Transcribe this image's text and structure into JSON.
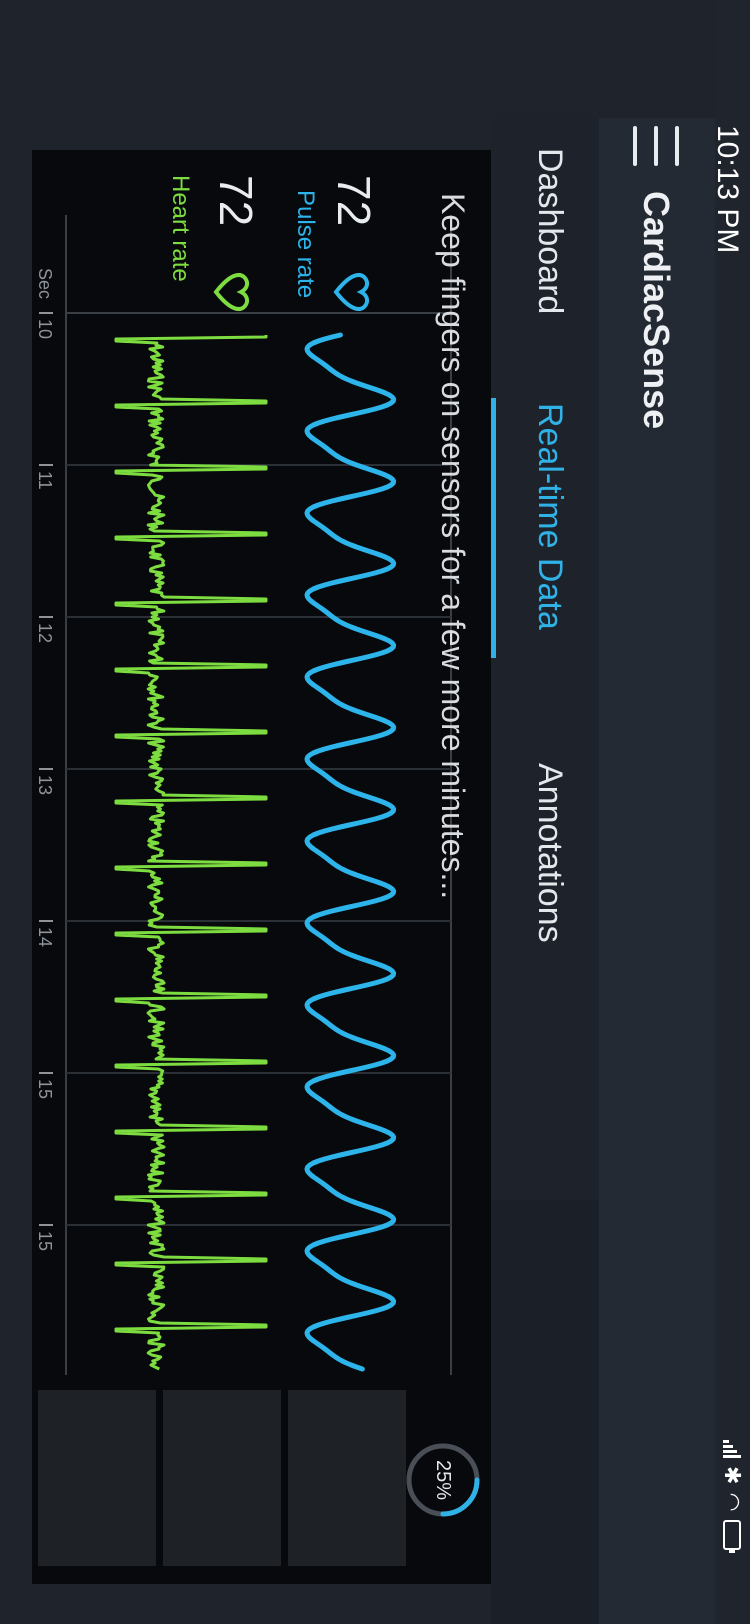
{
  "status_bar": {
    "time": "10:13 PM"
  },
  "app": {
    "title": "CardiacSense"
  },
  "tabs": [
    {
      "label": "Dashboard"
    },
    {
      "label": "Real-time Data",
      "active": true
    },
    {
      "label": "Annotations"
    }
  ],
  "panel": {
    "guidance": "Keep fingers on sensors for a few more minutes...",
    "progress": {
      "percent_label": "25%",
      "value": 0.25
    },
    "pulse": {
      "value": "72",
      "label": "Pulse rate",
      "color": "#2db4ea"
    },
    "heart": {
      "value": "72",
      "label": "Heart rate",
      "color": "#7ddc3f"
    },
    "time_axis": {
      "prefix": "Sec",
      "ticks": [
        "10",
        "11",
        "12",
        "13",
        "14",
        "15",
        "15"
      ]
    }
  },
  "colors": {
    "accent": "#30b2e6",
    "pulse": "#2db4ea",
    "ecg": "#7ddc3f",
    "background": "#07090c"
  }
}
